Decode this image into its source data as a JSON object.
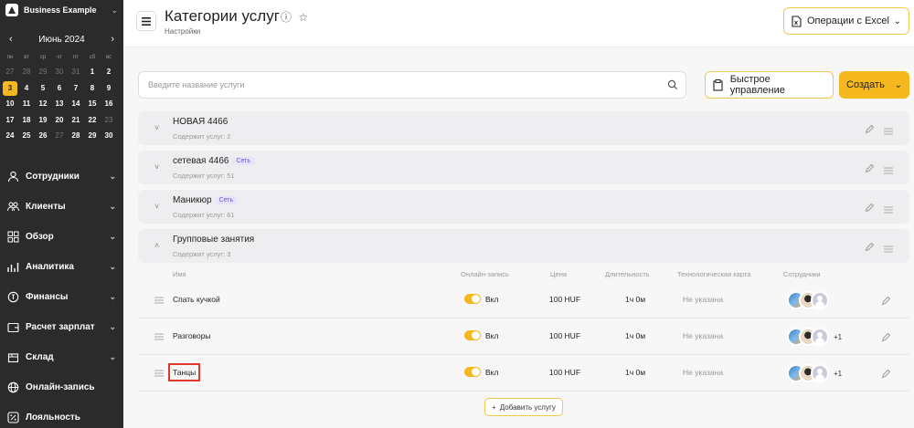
{
  "brand": {
    "name": "Business Example"
  },
  "calendar": {
    "month": "Июнь 2024",
    "weekdays": [
      "пн",
      "вт",
      "ср",
      "чт",
      "пт",
      "сб",
      "вс"
    ],
    "weeks": [
      [
        "27",
        "28",
        "29",
        "30",
        "31",
        "1",
        "2"
      ],
      [
        "3",
        "4",
        "5",
        "6",
        "7",
        "8",
        "9"
      ],
      [
        "10",
        "11",
        "12",
        "13",
        "14",
        "15",
        "16"
      ],
      [
        "17",
        "18",
        "19",
        "20",
        "21",
        "22",
        "23"
      ],
      [
        "24",
        "25",
        "26",
        "27",
        "28",
        "29",
        "30"
      ]
    ],
    "muted": [
      [
        0,
        0
      ],
      [
        0,
        1
      ],
      [
        0,
        2
      ],
      [
        0,
        3
      ],
      [
        0,
        4
      ],
      [
        3,
        6
      ],
      [
        4,
        3
      ]
    ],
    "today": [
      1,
      0
    ]
  },
  "nav": {
    "items": [
      {
        "label": "Сотрудники",
        "icon": "user-icon",
        "chev": true
      },
      {
        "label": "Клиенты",
        "icon": "users-icon",
        "chev": true
      },
      {
        "label": "Обзор",
        "icon": "grid-icon",
        "chev": true
      },
      {
        "label": "Аналитика",
        "icon": "chart-icon",
        "chev": true
      },
      {
        "label": "Финансы",
        "icon": "coin-icon",
        "chev": true
      },
      {
        "label": "Расчет зарплат",
        "icon": "wallet-icon",
        "chev": true
      },
      {
        "label": "Склад",
        "icon": "box-icon",
        "chev": true
      },
      {
        "label": "Онлайн-запись",
        "icon": "globe-icon",
        "chev": false
      },
      {
        "label": "Лояльность",
        "icon": "percent-icon",
        "chev": false
      }
    ]
  },
  "header": {
    "title": "Категории услуг",
    "subtitle": "Настройки",
    "excel_label": "Операции с Excel"
  },
  "toolbar": {
    "search_placeholder": "Введите название услуги",
    "quick_label": "Быстрое управление",
    "create_label": "Создать"
  },
  "categories": [
    {
      "name": "НОВАЯ 4466",
      "sub": "Содержит услуг: 2",
      "badge": "",
      "expanded": false
    },
    {
      "name": "сетевая 4466",
      "sub": "Содержит услуг: 51",
      "badge": "Сеть",
      "expanded": false
    },
    {
      "name": "Маникюр",
      "sub": "Содержит услуг: 61",
      "badge": "Сеть",
      "expanded": false
    },
    {
      "name": "Групповые занятия",
      "sub": "Содержит услуг: 3",
      "badge": "",
      "expanded": true
    }
  ],
  "table": {
    "headers": {
      "name": "Имя",
      "online": "Онлайн-запись",
      "price": "Цена",
      "duration": "Длительность",
      "techcard": "Технологическая карта",
      "staff": "Сотрудники"
    },
    "rows": [
      {
        "name": "Спать кучкой",
        "online": "Вкл",
        "online_on": true,
        "price": "100 HUF",
        "duration": "1ч 0м",
        "techcard": "Не указана",
        "extra": ""
      },
      {
        "name": "Разговоры",
        "online": "Вкл",
        "online_on": true,
        "price": "100 HUF",
        "duration": "1ч 0м",
        "techcard": "Не указана",
        "extra": "+1"
      },
      {
        "name": "Танцы",
        "online": "Вкл",
        "online_on": true,
        "price": "100 HUF",
        "duration": "1ч 0м",
        "techcard": "Не указана",
        "extra": "+1"
      }
    ]
  },
  "add_service_label": "Добавить услугу",
  "colors": {
    "accent": "#f5b81e",
    "sidebar": "#2b2b2b",
    "badge": "#6a55d6",
    "highlight": "#e03a2b"
  }
}
